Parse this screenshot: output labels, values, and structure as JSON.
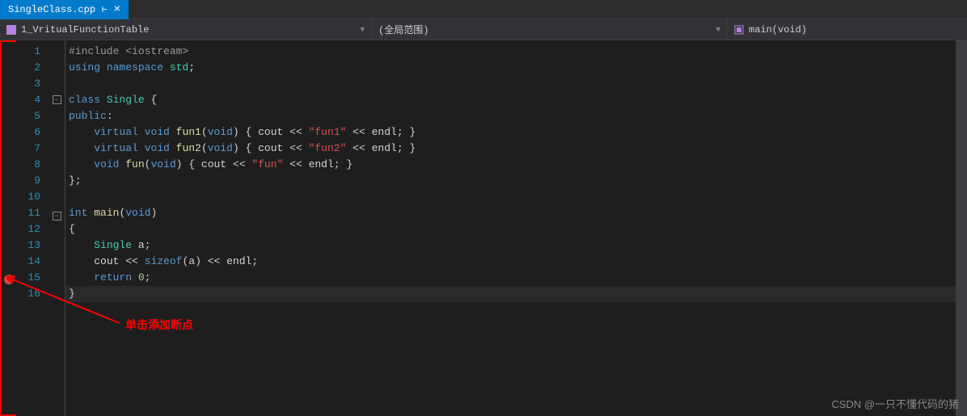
{
  "tab": {
    "filename": "SingleClass.cpp",
    "pinned": true
  },
  "nav": {
    "project": "1_VritualFunctionTable",
    "scope": "(全局范围)",
    "function": "main(void)"
  },
  "code": {
    "lines": [
      {
        "n": 1,
        "tokens": [
          {
            "t": "pp",
            "v": "#include "
          },
          {
            "t": "pp",
            "v": "<iostream>"
          }
        ]
      },
      {
        "n": 2,
        "tokens": [
          {
            "t": "kw",
            "v": "using "
          },
          {
            "t": "kw",
            "v": "namespace "
          },
          {
            "t": "cls",
            "v": "std"
          },
          {
            "t": "punc",
            "v": ";"
          }
        ]
      },
      {
        "n": 3,
        "tokens": []
      },
      {
        "n": 4,
        "fold": true,
        "tokens": [
          {
            "t": "kw",
            "v": "class "
          },
          {
            "t": "cls",
            "v": "Single "
          },
          {
            "t": "punc",
            "v": "{"
          }
        ]
      },
      {
        "n": 5,
        "tokens": [
          {
            "t": "kw",
            "v": "public"
          },
          {
            "t": "punc",
            "v": ":"
          }
        ]
      },
      {
        "n": 6,
        "tokens": [
          {
            "t": "indent-guide",
            "v": "    "
          },
          {
            "t": "kw",
            "v": "virtual "
          },
          {
            "t": "kw",
            "v": "void "
          },
          {
            "t": "fn",
            "v": "fun1"
          },
          {
            "t": "punc",
            "v": "("
          },
          {
            "t": "kw",
            "v": "void"
          },
          {
            "t": "punc",
            "v": ") { "
          },
          {
            "t": "op",
            "v": "cout"
          },
          {
            "t": "punc",
            "v": " << "
          },
          {
            "t": "str",
            "v": "\"fun1\""
          },
          {
            "t": "punc",
            "v": " << "
          },
          {
            "t": "op",
            "v": "endl"
          },
          {
            "t": "punc",
            "v": "; }"
          }
        ]
      },
      {
        "n": 7,
        "tokens": [
          {
            "t": "indent-guide",
            "v": "    "
          },
          {
            "t": "kw",
            "v": "virtual "
          },
          {
            "t": "kw",
            "v": "void "
          },
          {
            "t": "fn",
            "v": "fun2"
          },
          {
            "t": "punc",
            "v": "("
          },
          {
            "t": "kw",
            "v": "void"
          },
          {
            "t": "punc",
            "v": ") { "
          },
          {
            "t": "op",
            "v": "cout"
          },
          {
            "t": "punc",
            "v": " << "
          },
          {
            "t": "str",
            "v": "\"fun2\""
          },
          {
            "t": "punc",
            "v": " << "
          },
          {
            "t": "op",
            "v": "endl"
          },
          {
            "t": "punc",
            "v": "; }"
          }
        ]
      },
      {
        "n": 8,
        "tokens": [
          {
            "t": "indent-guide",
            "v": "    "
          },
          {
            "t": "kw",
            "v": "void "
          },
          {
            "t": "fn",
            "v": "fun"
          },
          {
            "t": "punc",
            "v": "("
          },
          {
            "t": "kw",
            "v": "void"
          },
          {
            "t": "punc",
            "v": ") { "
          },
          {
            "t": "op",
            "v": "cout"
          },
          {
            "t": "punc",
            "v": " << "
          },
          {
            "t": "str",
            "v": "\"fun\""
          },
          {
            "t": "punc",
            "v": " << "
          },
          {
            "t": "op",
            "v": "endl"
          },
          {
            "t": "punc",
            "v": "; }"
          }
        ]
      },
      {
        "n": 9,
        "tokens": [
          {
            "t": "punc",
            "v": "};"
          }
        ]
      },
      {
        "n": 10,
        "tokens": []
      },
      {
        "n": 11,
        "fold": true,
        "tokens": [
          {
            "t": "kw",
            "v": "int "
          },
          {
            "t": "fn",
            "v": "main"
          },
          {
            "t": "punc",
            "v": "("
          },
          {
            "t": "kw",
            "v": "void"
          },
          {
            "t": "punc",
            "v": ")"
          }
        ]
      },
      {
        "n": 12,
        "tokens": [
          {
            "t": "punc",
            "v": "{"
          }
        ]
      },
      {
        "n": 13,
        "tokens": [
          {
            "t": "indent-guide",
            "v": "    "
          },
          {
            "t": "cls",
            "v": "Single "
          },
          {
            "t": "op",
            "v": "a"
          },
          {
            "t": "punc",
            "v": ";"
          }
        ]
      },
      {
        "n": 14,
        "tokens": [
          {
            "t": "indent-guide",
            "v": "    "
          },
          {
            "t": "op",
            "v": "cout"
          },
          {
            "t": "punc",
            "v": " << "
          },
          {
            "t": "kw",
            "v": "sizeof"
          },
          {
            "t": "punc",
            "v": "("
          },
          {
            "t": "op",
            "v": "a"
          },
          {
            "t": "punc",
            "v": ") << "
          },
          {
            "t": "op",
            "v": "endl"
          },
          {
            "t": "punc",
            "v": ";"
          }
        ]
      },
      {
        "n": 15,
        "breakpoint": true,
        "tokens": [
          {
            "t": "indent-guide",
            "v": "    "
          },
          {
            "t": "kw",
            "v": "return "
          },
          {
            "t": "num",
            "v": "0"
          },
          {
            "t": "punc",
            "v": ";"
          }
        ]
      },
      {
        "n": 16,
        "highlight": true,
        "tokens": [
          {
            "t": "punc",
            "v": "}"
          }
        ]
      }
    ]
  },
  "annotation": {
    "text": "单击添加断点"
  },
  "watermark": "CSDN @一只不懂代码的猪"
}
